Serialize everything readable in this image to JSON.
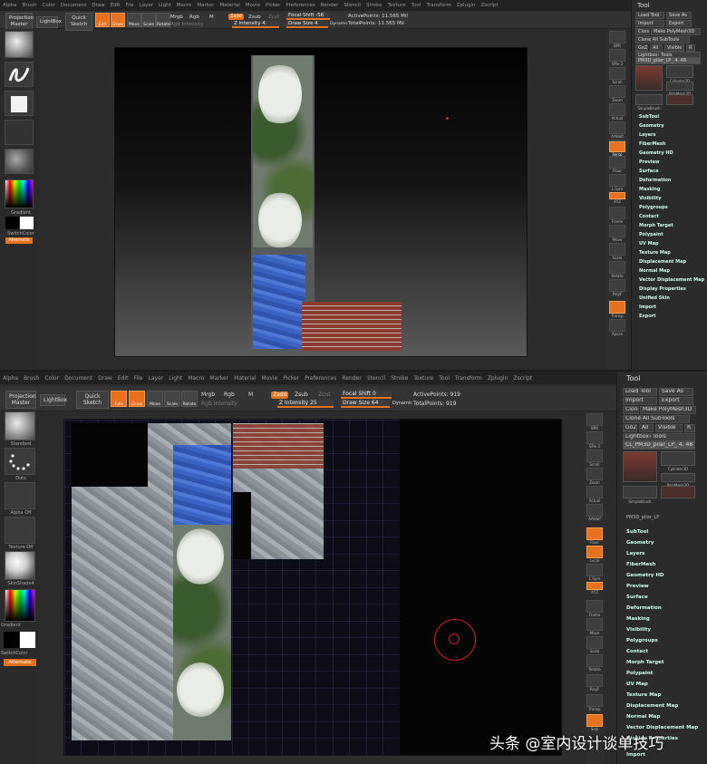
{
  "menu": [
    "Alpha",
    "Brush",
    "Color",
    "Document",
    "Draw",
    "Edit",
    "File",
    "Layer",
    "Light",
    "Macro",
    "Marker",
    "Material",
    "Movie",
    "Picker",
    "Preferences",
    "Render",
    "Stencil",
    "Stroke",
    "Texture",
    "Tool",
    "Transform",
    "Zplugin",
    "Zscript"
  ],
  "toolbar": {
    "projection_master": "Projection Master",
    "lightbox": "LightBox",
    "quick_sketch": "Quick Sketch",
    "edit": "Edit",
    "draw": "Draw",
    "move": "Move",
    "scale": "Scale",
    "rotate": "Rotate",
    "mrgb": "Mrgb",
    "rgb": "Rgb",
    "m": "M",
    "rgb_intensity": "Rgb Intensity",
    "zadd": "Zadd",
    "zsub": "Zsub",
    "zcut": "Zcut",
    "focal_shift_label": "Focal Shift",
    "draw_size_label": "Draw Size",
    "dynamic": "Dynamic",
    "z_intensity_label": "Z Intensity",
    "active_points_label": "ActivePoints:",
    "total_points_label": "TotalPoints:"
  },
  "top": {
    "focal_shift": "-56",
    "z_intensity": "4",
    "draw_size": "4",
    "active_points": "11.565 Mil",
    "total_points": "11.565 Mil"
  },
  "bottom": {
    "focal_shift": "0",
    "z_intensity": "25",
    "draw_size": "64",
    "active_points": "919",
    "total_points": "919"
  },
  "shelf": {
    "gradient": "Gradient",
    "switchcolor": "SwitchColor",
    "alternate": "Alternate",
    "standard": "Standard",
    "dots": "Dots",
    "alpha_off": "Alpha Off",
    "texture_off": "Texture Off",
    "matcap": "SkinShade4"
  },
  "dock": {
    "bpr": "BPR",
    "spix": "SPix 3",
    "scroll": "Scroll",
    "zoom": "Zoom",
    "actual": "Actual",
    "aahalf": "AAHalf",
    "persp": "Persp",
    "floor": "Floor",
    "local": "Local",
    "lsym": "L.Sym",
    "xyz": "XYZ",
    "frame": "Frame",
    "move": "Move",
    "scale": "Scale",
    "rotate": "Rotate",
    "polyf": "PolyF",
    "transp": "Transp",
    "solo": "Solo",
    "xpose": "Xpose"
  },
  "panel": {
    "title": "Tool",
    "load_tool": "Load Tool",
    "save_as": "Save As",
    "import": "Import",
    "export": "Export",
    "clone": "Clone",
    "make_polymesh": "Make PolyMesh3D",
    "clone_all": "Clone All SubTools",
    "goz": "GoZ",
    "all": "All",
    "visible": "Visible",
    "r": "R",
    "lightbox_tools": "Lightbox› Tools",
    "current_tool_top": "PM3D_pilar_LP_ 4. 48",
    "current_tool_bottom": "CL_PM3D_pilar_LP_ 4. 48",
    "cylinder": "Cylinder3D",
    "polymesh": "PolyMesh3D",
    "simplebrush": "SimpleBrush",
    "pm3d_pilar": "PM3D_pilar_LP",
    "sections": [
      "SubTool",
      "Geometry",
      "Layers",
      "FiberMesh",
      "Geometry HD",
      "Preview",
      "Surface",
      "Deformation",
      "Masking",
      "Visibility",
      "Polygroups",
      "Contact",
      "Morph Target",
      "Polypaint",
      "UV Map",
      "Texture Map",
      "Displacement Map",
      "Normal Map",
      "Vector Displacement Map",
      "Display Properties",
      "Unified Skin",
      "Import",
      "Export"
    ]
  },
  "watermark": "头条 @室内设计谈单技巧",
  "colors": {
    "accent": "#e9711e",
    "panel_bg": "#2b2b2b",
    "viewport_bg": "#050505"
  }
}
